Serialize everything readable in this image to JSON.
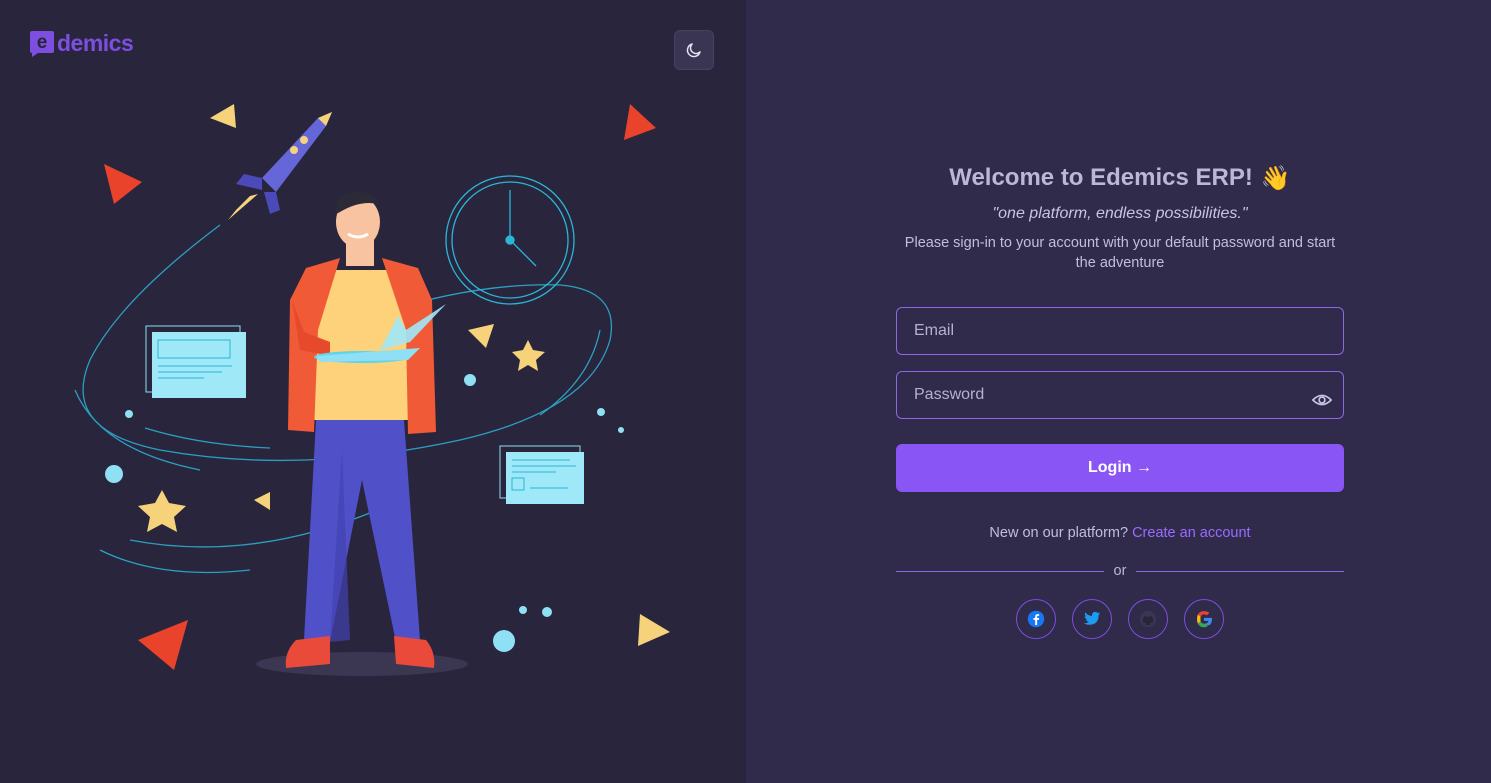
{
  "brand": {
    "name": "demics",
    "logo_letter": "e"
  },
  "theme_toggle": {
    "icon": "moon-icon"
  },
  "welcome": {
    "title": "Welcome to Edemics ERP!",
    "emoji": "👋"
  },
  "tagline": "\"one platform, endless possibilities.\"",
  "instructions": "Please sign-in to your account with your default password and start the adventure",
  "form": {
    "email_placeholder": "Email",
    "email_value": "",
    "password_placeholder": "Password",
    "password_value": "",
    "login_label": "Login →"
  },
  "signup": {
    "prompt": "New on our platform?",
    "link": "Create an account"
  },
  "divider_text": "or",
  "socials": [
    {
      "name": "facebook",
      "icon": "facebook-icon",
      "color": "#1877f2"
    },
    {
      "name": "twitter",
      "icon": "twitter-icon",
      "color": "#1d9bf0"
    },
    {
      "name": "github",
      "icon": "github-icon",
      "color": "#24292f"
    },
    {
      "name": "google",
      "icon": "google-icon",
      "color": "#ea4335"
    }
  ],
  "colors": {
    "accent": "#8a55f5",
    "left_bg": "#29253c",
    "right_bg": "#302a4b"
  }
}
